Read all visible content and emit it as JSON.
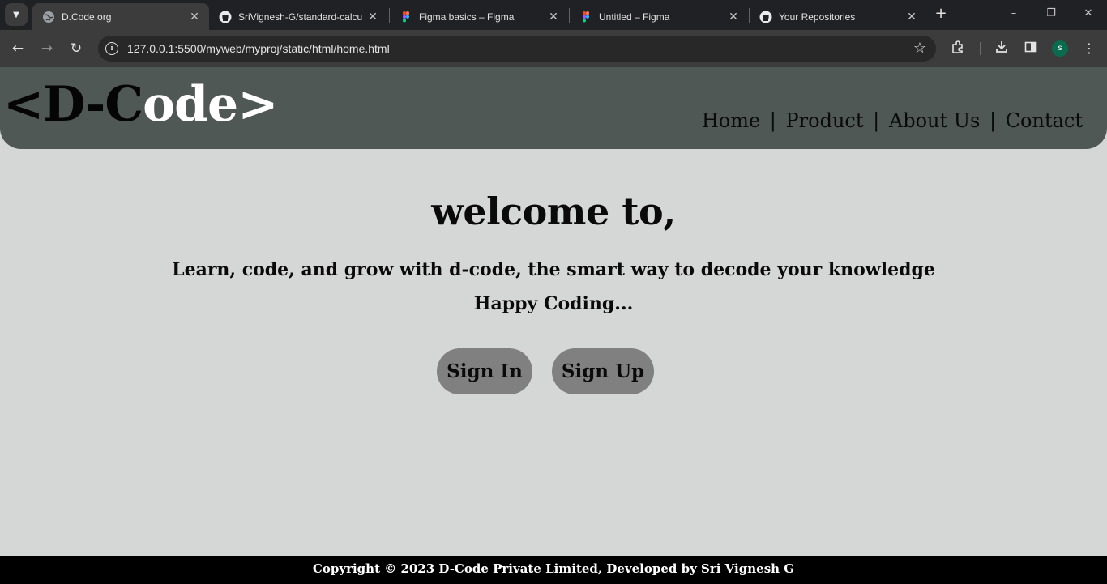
{
  "browser": {
    "tabs": [
      {
        "title": "D.Code.org",
        "favicon": "globe-icon",
        "active": true
      },
      {
        "title": "SriVignesh-G/standard-calcu",
        "favicon": "github-icon",
        "active": false
      },
      {
        "title": "Figma basics – Figma",
        "favicon": "figma-icon",
        "active": false
      },
      {
        "title": "Untitled – Figma",
        "favicon": "figma-icon",
        "active": false
      },
      {
        "title": "Your Repositories",
        "favicon": "github-icon",
        "active": false
      }
    ],
    "close_glyph": "✕",
    "new_tab_glyph": "+",
    "url": "127.0.0.1:5500/myweb/myproj/static/html/home.html",
    "profile_initial": "s",
    "colors": {
      "tabstrip": "#202124",
      "toolbar": "#3c3c3c",
      "omnibox": "#282828",
      "profile": "#0b6b4f"
    }
  },
  "site": {
    "logo": {
      "dark_part": "<D-C",
      "light_part": "ode>"
    },
    "nav": [
      {
        "label": "Home"
      },
      {
        "label": "Product"
      },
      {
        "label": "About Us"
      },
      {
        "label": "Contact"
      }
    ],
    "nav_separator": "|",
    "hero": {
      "heading": "welcome to,",
      "tagline": "Learn, code, and grow with d-code, the smart way to decode your knowledge",
      "subline": "Happy Coding..."
    },
    "buttons": {
      "sign_in": "Sign In",
      "sign_up": "Sign Up"
    },
    "footer": "Copyright © 2023 D-Code Private Limited, Developed by Sri Vignesh G",
    "colors": {
      "header": "#4f5854",
      "page": "#d5d7d6",
      "button": "#7f807f",
      "footer": "#000000"
    }
  }
}
